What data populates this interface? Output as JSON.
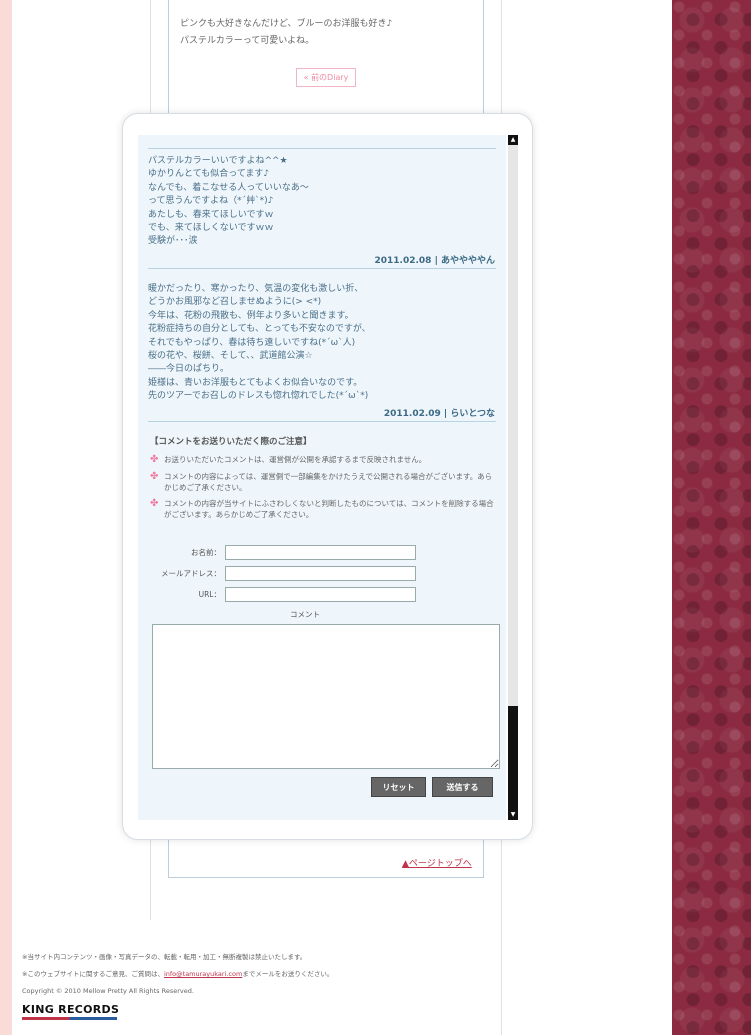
{
  "background_top": {
    "lines": [
      "ピンクも大好きなんだけど、ブルーのお洋服も好き♪",
      "パステルカラーって可愛いよね。"
    ],
    "prev_diary_label": "« 前のDiary"
  },
  "comments": [
    {
      "lines": [
        "パステルカラーいいですよね^^★",
        "ゆかりんとても似合ってます♪",
        "なんでも、着こなせる人っていいなあ～",
        "って思うんですよね（*´艸`*)♪",
        "あたしも、春来てほしいですｗ",
        "でも、来てほしくないですｗｗ",
        "受験が･･･涙"
      ],
      "meta": "2011.02.08 | あややややん"
    },
    {
      "lines": [
        "暖かだったり、寒かったり、気温の変化も激しい折、",
        "どうかお風邪など召しませぬように(> <*)",
        "今年は、花粉の飛散も、例年より多いと聞きます。",
        "花粉症持ちの自分としても、とっても不安なのですが、",
        "それでもやっぱり、春は待ち遠しいですね(*´ω`人)",
        "桜の花や、桜餅、そして、、武道館公演☆",
        "――今日のぱちり。",
        "姫様は、青いお洋服もとてもよくお似合いなのです。",
        "先のツアーでお召しのドレスも惚れ惚れでした(*´ω`*)"
      ],
      "meta": "2011.02.09 | らいとつな"
    }
  ],
  "notice": {
    "title": "【コメントをお送りいただく際のご注意】",
    "items": [
      "お送りいただいたコメントは、運営側が公開を承認するまで反映されません。",
      "コメントの内容によっては、運営側で一部編集をかけたうえで公開される場合がございます。あらかじめご了承ください。",
      "コメントの内容が当サイトにふさわしくないと判断したものについては、コメントを削除する場合がございます。あらかじめご了承ください。"
    ]
  },
  "form": {
    "name_label": "お名前：",
    "email_label": "メールアドレス：",
    "url_label": "URL：",
    "name_value": "",
    "email_value": "",
    "url_value": "",
    "comment_label": "コメント",
    "comment_value": "",
    "reset_label": "リセット",
    "submit_label": "送信する"
  },
  "page_top_label": "▲ページトップへ",
  "footer": {
    "line1": "※当サイト内コンテンツ・画像・写真データの、転載・転用・加工・無断複製は禁止いたします。",
    "line2_prefix": "※このウェブサイトに関するご意見、ご質問は、",
    "line2_email": "info@tamurayukari.com",
    "line2_suffix": "までメールをお送りください。",
    "copyright": "Copyright © 2010 Mellow Pretty All Rights Reserved.",
    "logo": "KING RECORDS"
  },
  "colors": {
    "accent_pink": "#f08aa3",
    "text_blue": "#4a6f88",
    "side_pattern": "#8b2a41"
  },
  "icons": {
    "bullet": "flower-icon",
    "scroll_up": "arrow-up-icon",
    "scroll_down": "arrow-down-icon"
  }
}
